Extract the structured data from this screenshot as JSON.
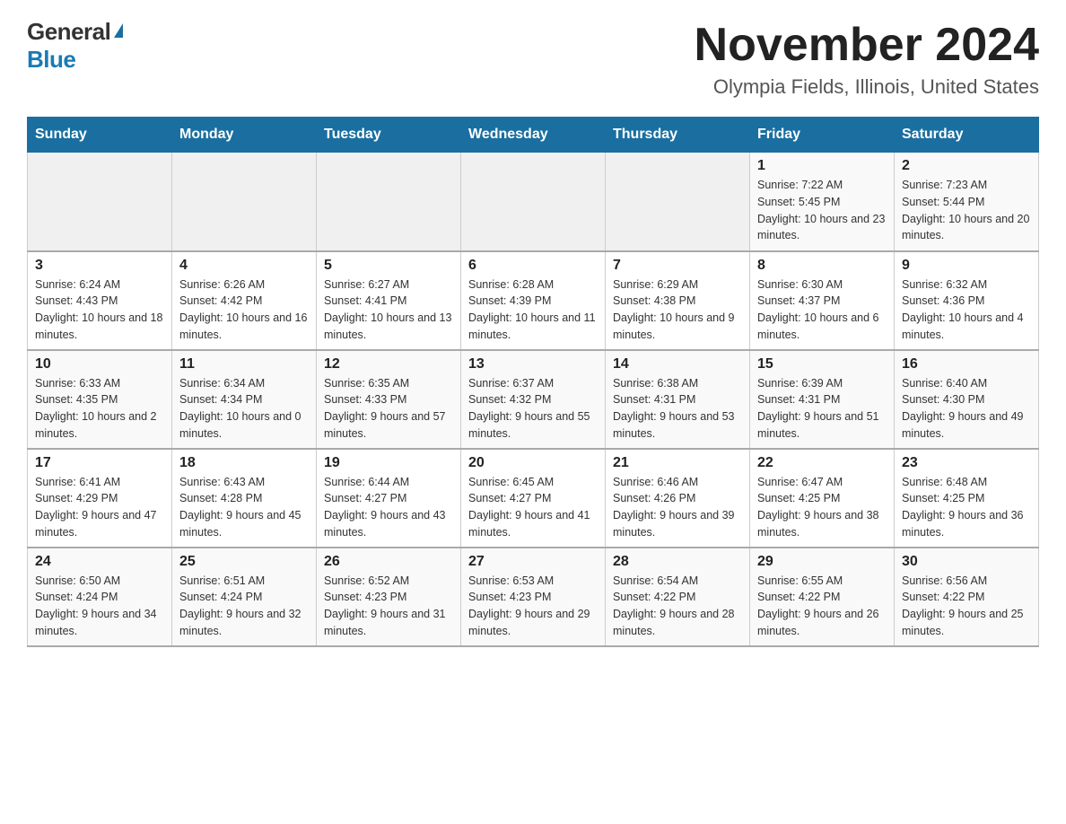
{
  "logo": {
    "general": "General",
    "blue": "Blue"
  },
  "title": "November 2024",
  "location": "Olympia Fields, Illinois, United States",
  "days_of_week": [
    "Sunday",
    "Monday",
    "Tuesday",
    "Wednesday",
    "Thursday",
    "Friday",
    "Saturday"
  ],
  "weeks": [
    [
      {
        "day": "",
        "info": ""
      },
      {
        "day": "",
        "info": ""
      },
      {
        "day": "",
        "info": ""
      },
      {
        "day": "",
        "info": ""
      },
      {
        "day": "",
        "info": ""
      },
      {
        "day": "1",
        "info": "Sunrise: 7:22 AM\nSunset: 5:45 PM\nDaylight: 10 hours and 23 minutes."
      },
      {
        "day": "2",
        "info": "Sunrise: 7:23 AM\nSunset: 5:44 PM\nDaylight: 10 hours and 20 minutes."
      }
    ],
    [
      {
        "day": "3",
        "info": "Sunrise: 6:24 AM\nSunset: 4:43 PM\nDaylight: 10 hours and 18 minutes."
      },
      {
        "day": "4",
        "info": "Sunrise: 6:26 AM\nSunset: 4:42 PM\nDaylight: 10 hours and 16 minutes."
      },
      {
        "day": "5",
        "info": "Sunrise: 6:27 AM\nSunset: 4:41 PM\nDaylight: 10 hours and 13 minutes."
      },
      {
        "day": "6",
        "info": "Sunrise: 6:28 AM\nSunset: 4:39 PM\nDaylight: 10 hours and 11 minutes."
      },
      {
        "day": "7",
        "info": "Sunrise: 6:29 AM\nSunset: 4:38 PM\nDaylight: 10 hours and 9 minutes."
      },
      {
        "day": "8",
        "info": "Sunrise: 6:30 AM\nSunset: 4:37 PM\nDaylight: 10 hours and 6 minutes."
      },
      {
        "day": "9",
        "info": "Sunrise: 6:32 AM\nSunset: 4:36 PM\nDaylight: 10 hours and 4 minutes."
      }
    ],
    [
      {
        "day": "10",
        "info": "Sunrise: 6:33 AM\nSunset: 4:35 PM\nDaylight: 10 hours and 2 minutes."
      },
      {
        "day": "11",
        "info": "Sunrise: 6:34 AM\nSunset: 4:34 PM\nDaylight: 10 hours and 0 minutes."
      },
      {
        "day": "12",
        "info": "Sunrise: 6:35 AM\nSunset: 4:33 PM\nDaylight: 9 hours and 57 minutes."
      },
      {
        "day": "13",
        "info": "Sunrise: 6:37 AM\nSunset: 4:32 PM\nDaylight: 9 hours and 55 minutes."
      },
      {
        "day": "14",
        "info": "Sunrise: 6:38 AM\nSunset: 4:31 PM\nDaylight: 9 hours and 53 minutes."
      },
      {
        "day": "15",
        "info": "Sunrise: 6:39 AM\nSunset: 4:31 PM\nDaylight: 9 hours and 51 minutes."
      },
      {
        "day": "16",
        "info": "Sunrise: 6:40 AM\nSunset: 4:30 PM\nDaylight: 9 hours and 49 minutes."
      }
    ],
    [
      {
        "day": "17",
        "info": "Sunrise: 6:41 AM\nSunset: 4:29 PM\nDaylight: 9 hours and 47 minutes."
      },
      {
        "day": "18",
        "info": "Sunrise: 6:43 AM\nSunset: 4:28 PM\nDaylight: 9 hours and 45 minutes."
      },
      {
        "day": "19",
        "info": "Sunrise: 6:44 AM\nSunset: 4:27 PM\nDaylight: 9 hours and 43 minutes."
      },
      {
        "day": "20",
        "info": "Sunrise: 6:45 AM\nSunset: 4:27 PM\nDaylight: 9 hours and 41 minutes."
      },
      {
        "day": "21",
        "info": "Sunrise: 6:46 AM\nSunset: 4:26 PM\nDaylight: 9 hours and 39 minutes."
      },
      {
        "day": "22",
        "info": "Sunrise: 6:47 AM\nSunset: 4:25 PM\nDaylight: 9 hours and 38 minutes."
      },
      {
        "day": "23",
        "info": "Sunrise: 6:48 AM\nSunset: 4:25 PM\nDaylight: 9 hours and 36 minutes."
      }
    ],
    [
      {
        "day": "24",
        "info": "Sunrise: 6:50 AM\nSunset: 4:24 PM\nDaylight: 9 hours and 34 minutes."
      },
      {
        "day": "25",
        "info": "Sunrise: 6:51 AM\nSunset: 4:24 PM\nDaylight: 9 hours and 32 minutes."
      },
      {
        "day": "26",
        "info": "Sunrise: 6:52 AM\nSunset: 4:23 PM\nDaylight: 9 hours and 31 minutes."
      },
      {
        "day": "27",
        "info": "Sunrise: 6:53 AM\nSunset: 4:23 PM\nDaylight: 9 hours and 29 minutes."
      },
      {
        "day": "28",
        "info": "Sunrise: 6:54 AM\nSunset: 4:22 PM\nDaylight: 9 hours and 28 minutes."
      },
      {
        "day": "29",
        "info": "Sunrise: 6:55 AM\nSunset: 4:22 PM\nDaylight: 9 hours and 26 minutes."
      },
      {
        "day": "30",
        "info": "Sunrise: 6:56 AM\nSunset: 4:22 PM\nDaylight: 9 hours and 25 minutes."
      }
    ]
  ]
}
